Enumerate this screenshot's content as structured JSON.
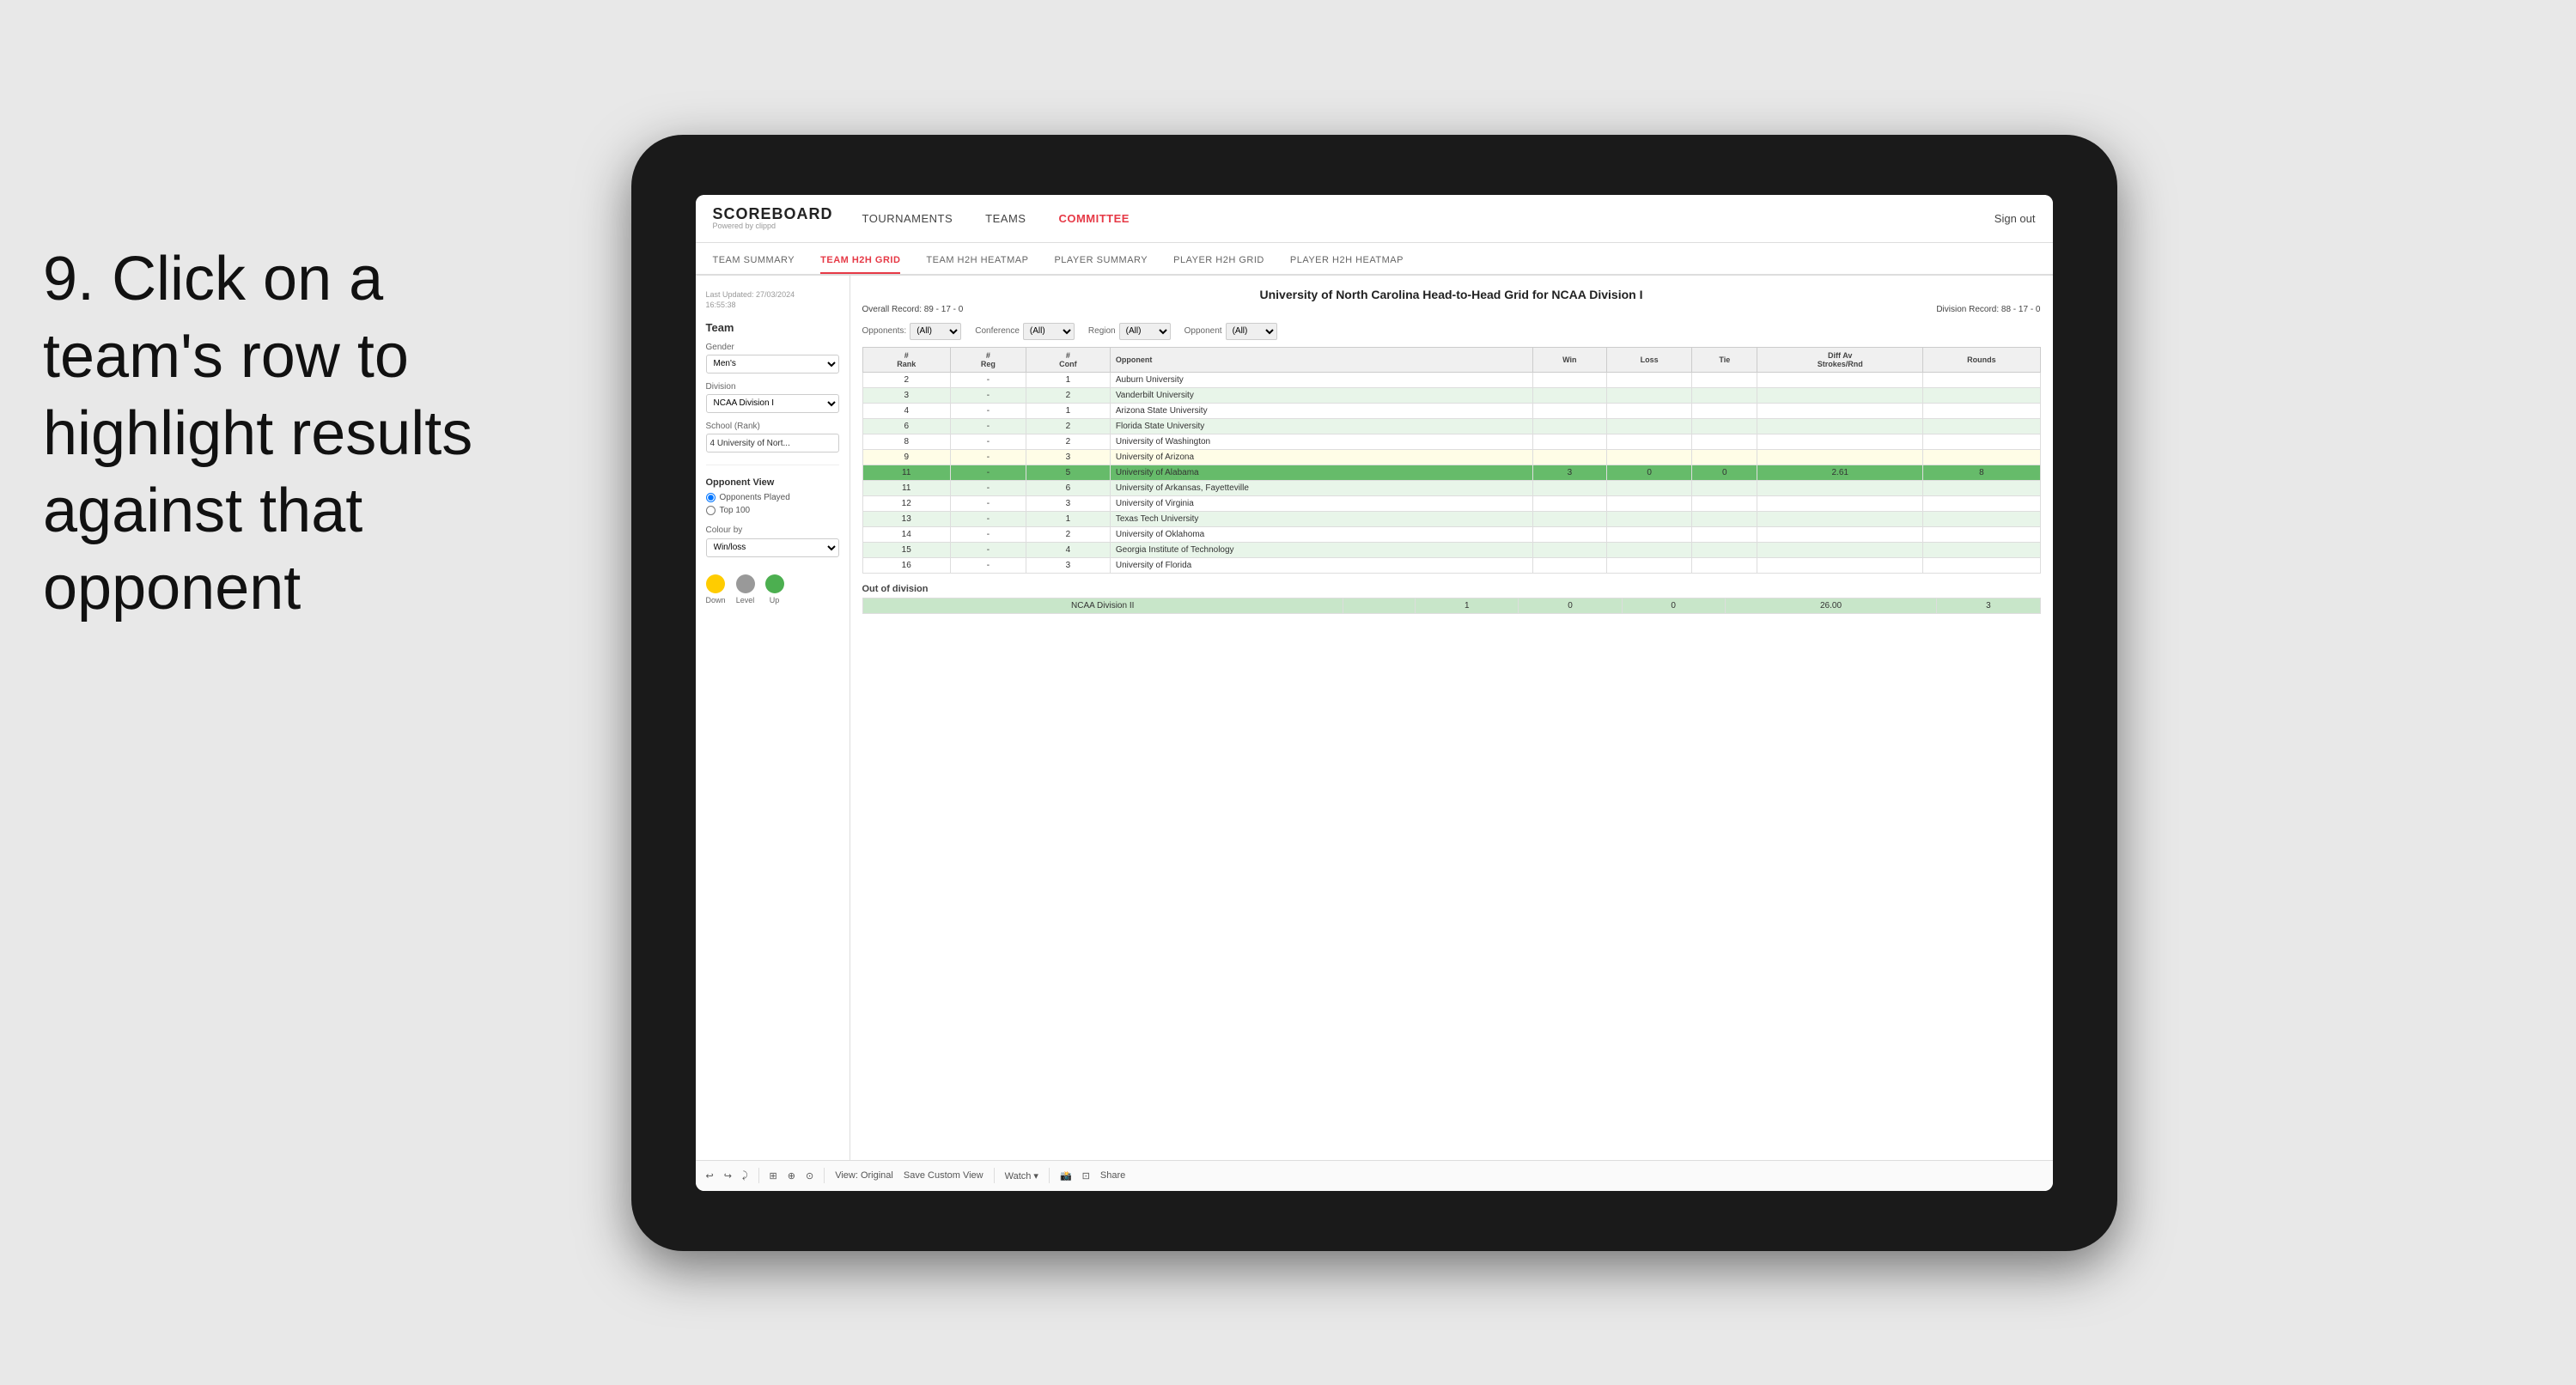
{
  "instruction": {
    "step": "9.",
    "text": "Click on a team's row to highlight results against that opponent"
  },
  "nav": {
    "logo": "SCOREBOARD",
    "powered_by": "Powered by clippd",
    "items": [
      "TOURNAMENTS",
      "TEAMS",
      "COMMITTEE"
    ],
    "sign_out": "Sign out"
  },
  "sub_nav": {
    "items": [
      "TEAM SUMMARY",
      "TEAM H2H GRID",
      "TEAM H2H HEATMAP",
      "PLAYER SUMMARY",
      "PLAYER H2H GRID",
      "PLAYER H2H HEATMAP"
    ],
    "active": "TEAM H2H GRID"
  },
  "sidebar": {
    "timestamp_label": "Last Updated: 27/03/2024",
    "timestamp_time": "16:55:38",
    "team_label": "Team",
    "gender_label": "Gender",
    "gender_value": "Men's",
    "division_label": "Division",
    "division_value": "NCAA Division I",
    "school_label": "School (Rank)",
    "school_value": "4 University of Nort...",
    "opponent_view_label": "Opponent View",
    "radio_opponents": "Opponents Played",
    "radio_top100": "Top 100",
    "colour_by_label": "Colour by",
    "colour_by_value": "Win/loss",
    "legend": [
      {
        "label": "Down",
        "color": "#ffcc00"
      },
      {
        "label": "Level",
        "color": "#999999"
      },
      {
        "label": "Up",
        "color": "#4caf50"
      }
    ]
  },
  "grid": {
    "title": "University of North Carolina Head-to-Head Grid for NCAA Division I",
    "overall_record": "Overall Record: 89 - 17 - 0",
    "division_record": "Division Record: 88 - 17 - 0",
    "filters": {
      "opponents_label": "Opponents:",
      "opponents_value": "(All)",
      "conference_label": "Conference",
      "conference_value": "(All)",
      "region_label": "Region",
      "region_value": "(All)",
      "opponent_label": "Opponent",
      "opponent_value": "(All)"
    },
    "columns": [
      "#\nRank",
      "#\nReg",
      "#\nConf",
      "Opponent",
      "Win",
      "Loss",
      "Tie",
      "Diff Av\nStrokes/Rnd",
      "Rounds"
    ],
    "rows": [
      {
        "rank": "2",
        "reg": "-",
        "conf": "1",
        "opponent": "Auburn University",
        "win": "",
        "loss": "",
        "tie": "",
        "diff": "",
        "rounds": "",
        "style": "normal"
      },
      {
        "rank": "3",
        "reg": "-",
        "conf": "2",
        "opponent": "Vanderbilt University",
        "win": "",
        "loss": "",
        "tie": "",
        "diff": "",
        "rounds": "",
        "style": "light-green"
      },
      {
        "rank": "4",
        "reg": "-",
        "conf": "1",
        "opponent": "Arizona State University",
        "win": "",
        "loss": "",
        "tie": "",
        "diff": "",
        "rounds": "",
        "style": "normal"
      },
      {
        "rank": "6",
        "reg": "-",
        "conf": "2",
        "opponent": "Florida State University",
        "win": "",
        "loss": "",
        "tie": "",
        "diff": "",
        "rounds": "",
        "style": "light-green"
      },
      {
        "rank": "8",
        "reg": "-",
        "conf": "2",
        "opponent": "University of Washington",
        "win": "",
        "loss": "",
        "tie": "",
        "diff": "",
        "rounds": "",
        "style": "normal"
      },
      {
        "rank": "9",
        "reg": "-",
        "conf": "3",
        "opponent": "University of Arizona",
        "win": "",
        "loss": "",
        "tie": "",
        "diff": "",
        "rounds": "",
        "style": "light-yellow"
      },
      {
        "rank": "11",
        "reg": "-",
        "conf": "5",
        "opponent": "University of Alabama",
        "win": "3",
        "loss": "0",
        "tie": "0",
        "diff": "2.61",
        "rounds": "8",
        "style": "selected"
      },
      {
        "rank": "11",
        "reg": "-",
        "conf": "6",
        "opponent": "University of Arkansas, Fayetteville",
        "win": "",
        "loss": "",
        "tie": "",
        "diff": "",
        "rounds": "",
        "style": "light-green"
      },
      {
        "rank": "12",
        "reg": "-",
        "conf": "3",
        "opponent": "University of Virginia",
        "win": "",
        "loss": "",
        "tie": "",
        "diff": "",
        "rounds": "",
        "style": "normal"
      },
      {
        "rank": "13",
        "reg": "-",
        "conf": "1",
        "opponent": "Texas Tech University",
        "win": "",
        "loss": "",
        "tie": "",
        "diff": "",
        "rounds": "",
        "style": "light-green"
      },
      {
        "rank": "14",
        "reg": "-",
        "conf": "2",
        "opponent": "University of Oklahoma",
        "win": "",
        "loss": "",
        "tie": "",
        "diff": "",
        "rounds": "",
        "style": "normal"
      },
      {
        "rank": "15",
        "reg": "-",
        "conf": "4",
        "opponent": "Georgia Institute of Technology",
        "win": "",
        "loss": "",
        "tie": "",
        "diff": "",
        "rounds": "",
        "style": "light-green"
      },
      {
        "rank": "16",
        "reg": "-",
        "conf": "3",
        "opponent": "University of Florida",
        "win": "",
        "loss": "",
        "tie": "",
        "diff": "",
        "rounds": "",
        "style": "normal"
      }
    ],
    "out_of_division_label": "Out of division",
    "out_of_division_row": {
      "division": "NCAA Division II",
      "win": "1",
      "loss": "0",
      "tie": "0",
      "diff": "26.00",
      "rounds": "3"
    }
  },
  "toolbar": {
    "buttons": [
      "↩",
      "↪",
      "⤸",
      "⊞",
      "⊟",
      "⊕",
      "⊙",
      "View: Original",
      "Save Custom View",
      "Watch ▾",
      "📸",
      "⊡",
      "Share"
    ]
  }
}
